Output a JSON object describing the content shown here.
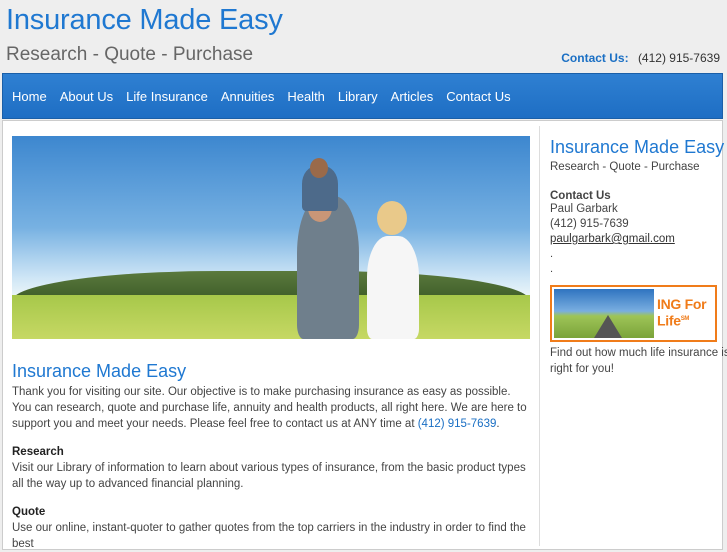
{
  "header": {
    "title": "Insurance Made Easy",
    "tagline": "Research - Quote - Purchase",
    "contact_label": "Contact Us:",
    "contact_phone": "(412) 915-7639"
  },
  "nav": {
    "items": [
      {
        "label": "Home"
      },
      {
        "label": "About Us"
      },
      {
        "label": "Life Insurance"
      },
      {
        "label": "Annuities"
      },
      {
        "label": "Health"
      },
      {
        "label": "Library"
      },
      {
        "label": "Articles"
      },
      {
        "label": "Contact Us"
      }
    ]
  },
  "main": {
    "heading": "Insurance Made Easy",
    "intro": "Thank you for visiting our site.  Our objective is to make purchasing insurance as easy as possible.  You can research, quote and purchase life, annuity and health products, all right here.  We are here to support you and meet your needs.  Please feel free to contact us at ANY time at ",
    "intro_phone": "(412) 915-7639",
    "intro_end": ".",
    "research_heading": "Research",
    "research_text": "Visit our Library of information to learn about various types of insurance, from the basic product types all the way up to advanced financial planning.",
    "quote_heading": "Quote",
    "quote_text": "Use our online, instant-quoter to gather quotes from the top carriers in the industry in order to find the best"
  },
  "sidebar": {
    "title": "Insurance Made Easy",
    "subtitle": "Research - Quote - Purchase",
    "contact_heading": "Contact Us",
    "name": "Paul Garbark",
    "phone": "(412) 915-7639",
    "email": "paulgarbark@gmail.com",
    "dot1": ".",
    "dot2": ".",
    "banner_text_1": "ING For",
    "banner_text_2": "Life",
    "banner_sm": "SM",
    "promo": "Find out how much life insurance is right for you!"
  },
  "colors": {
    "brand_blue": "#1f78d1",
    "nav_blue": "#2277cc",
    "ing_orange": "#f07c1a"
  }
}
